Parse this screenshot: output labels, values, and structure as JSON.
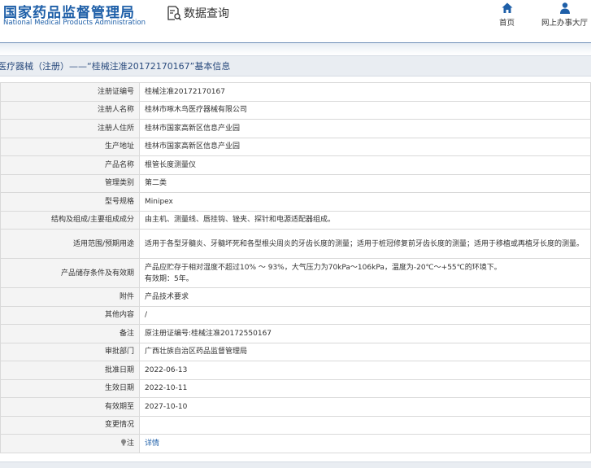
{
  "header": {
    "logo_cn": "国家药品监督管理局",
    "logo_en": "National Medical Products Administration",
    "query_label": "数据查询",
    "nav": [
      {
        "label": "首页",
        "icon": "home-icon"
      },
      {
        "label": "网上办事大厅",
        "icon": "user-icon"
      }
    ]
  },
  "breadcrumb": "医疗器械（注册）——“桂械注准20172170167”基本信息",
  "rows": [
    {
      "label": "注册证编号",
      "value": "桂械注准20172170167"
    },
    {
      "label": "注册人名称",
      "value": "桂林市啄木鸟医疗器械有限公司"
    },
    {
      "label": "注册人住所",
      "value": "桂林市国家高新区信息产业园"
    },
    {
      "label": "生产地址",
      "value": "桂林市国家高新区信息产业园"
    },
    {
      "label": "产品名称",
      "value": "根管长度测量仪"
    },
    {
      "label": "管理类别",
      "value": "第二类"
    },
    {
      "label": "型号规格",
      "value": "Minipex"
    },
    {
      "label": "结构及组成/主要组成成分",
      "value": "由主机、测量线、唇挂钩、锉夹、探针和电源适配器组成。"
    },
    {
      "label": "适用范围/预期用途",
      "value": "适用于各型牙髓炎、牙髓坏死和各型根尖周炎的牙齿长度的测量；适用于桩冠修复前牙齿长度的测量；适用于移植或再植牙长度的测量。"
    },
    {
      "label": "产品储存条件及有效期",
      "value": "产品应贮存于相对湿度不超过10% ～ 93%，大气压力为70kPa～106kPa，温度为-20℃～+55℃的环境下。",
      "value2": "有效期：5年。"
    },
    {
      "label": "附件",
      "value": "产品技术要求"
    },
    {
      "label": "其他内容",
      "value": "/"
    },
    {
      "label": "备注",
      "value": "原注册证编号:桂械注准20172550167"
    },
    {
      "label": "审批部门",
      "value": "广西壮族自治区药品监督管理局"
    },
    {
      "label": "批准日期",
      "value": "2022-06-13"
    },
    {
      "label": "生效日期",
      "value": "2022-10-11"
    },
    {
      "label": "有效期至",
      "value": "2027-10-10"
    },
    {
      "label": "变更情况",
      "value": ""
    },
    {
      "label": "注",
      "value": "详情"
    }
  ],
  "colors": {
    "brand_blue": "#1e5fa8",
    "link_blue": "#1e5fa8",
    "label_bg": "#f4f4f4"
  }
}
